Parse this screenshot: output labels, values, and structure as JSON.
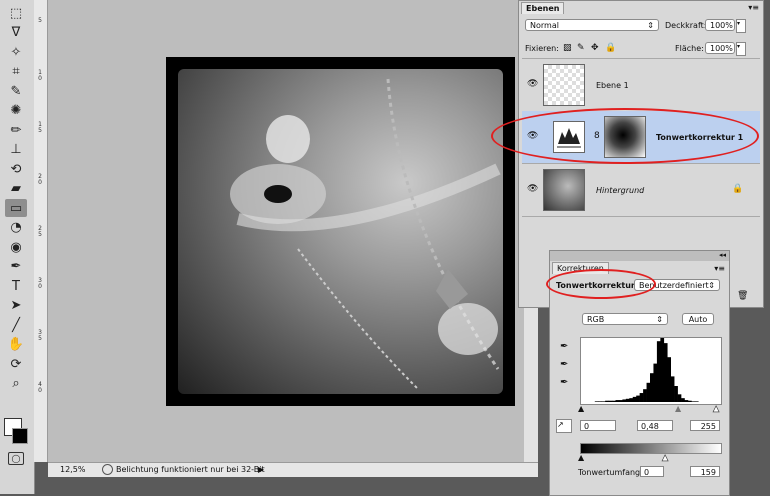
{
  "toolbar": {
    "tools": [
      "marquee-icon",
      "lasso-icon",
      "magic-wand-icon",
      "crop-icon",
      "eyedropper-icon",
      "healing-icon",
      "brush-icon",
      "stamp-icon",
      "history-brush-icon",
      "eraser-icon",
      "gradient-icon",
      "blur-icon",
      "dodge-icon",
      "pen-icon",
      "type-icon",
      "path-select-icon",
      "line-icon",
      "hand-icon",
      "rotate-icon",
      "zoom-icon"
    ]
  },
  "ruler": {
    "labels": [
      "5",
      "1 0",
      "1 5",
      "2 0",
      "2 5",
      "3 0",
      "3 5",
      "4 0"
    ]
  },
  "status": {
    "zoom": "12,5%",
    "message": "Belichtung funktioniert nur bei 32-Bit"
  },
  "layers_panel": {
    "tab": "Ebenen",
    "blend_mode": "Normal",
    "opacity_label": "Deckkraft:",
    "opacity": "100%",
    "lock_label": "Fixieren:",
    "fill_label": "Fläche:",
    "fill": "100%",
    "layers": [
      {
        "name": "Ebene 1"
      },
      {
        "name": "Tonwertkorrektur 1"
      },
      {
        "name": "Hintergrund"
      }
    ]
  },
  "corrections_panel": {
    "tab": "Korrekturen",
    "title": "Tonwertkorrektur",
    "preset": "Benutzerdefiniert",
    "channel": "RGB",
    "auto_label": "Auto",
    "input_black": "0",
    "input_gamma": "0,48",
    "input_white": "255",
    "output_label": "Tonwertumfang:",
    "output_black": "0",
    "output_white": "159",
    "histogram": [
      0,
      0,
      0,
      0,
      1,
      1,
      1,
      2,
      2,
      2,
      3,
      3,
      4,
      5,
      6,
      8,
      10,
      14,
      20,
      30,
      45,
      60,
      95,
      100,
      92,
      70,
      40,
      25,
      12,
      6,
      3,
      2,
      1,
      1,
      0,
      0,
      0,
      0,
      0,
      0
    ],
    "accent": "#e02020"
  }
}
